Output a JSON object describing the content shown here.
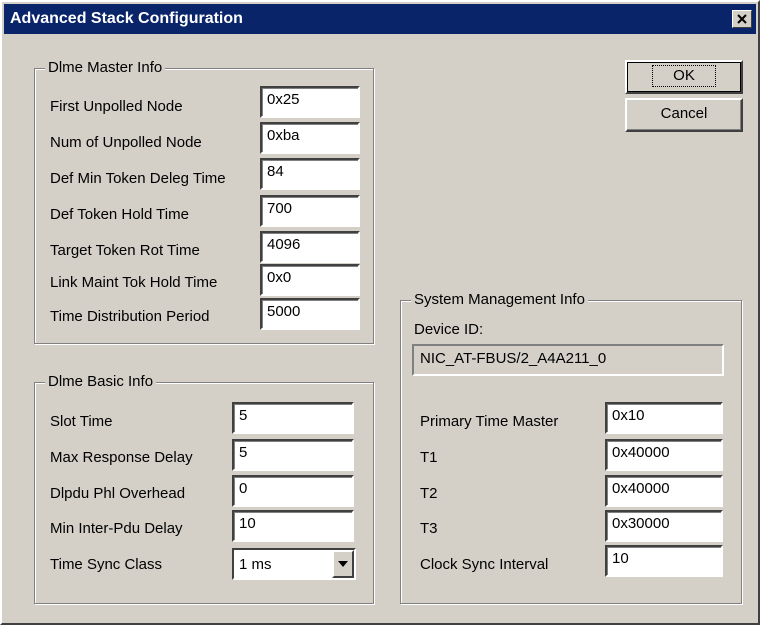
{
  "window": {
    "title": "Advanced Stack Configuration"
  },
  "buttons": {
    "ok": "OK",
    "cancel": "Cancel"
  },
  "dlme_master": {
    "legend": "Dlme Master Info",
    "fields": [
      {
        "label": "First Unpolled Node",
        "value": "0x25"
      },
      {
        "label": "Num of Unpolled Node",
        "value": "0xba"
      },
      {
        "label": "Def Min Token Deleg Time",
        "value": "84"
      },
      {
        "label": "Def Token Hold Time",
        "value": "700"
      },
      {
        "label": "Target Token Rot Time",
        "value": "4096"
      },
      {
        "label": "Link Maint Tok Hold Time",
        "value": "0x0"
      },
      {
        "label": "Time Distribution Period",
        "value": "5000"
      }
    ]
  },
  "dlme_basic": {
    "legend": "Dlme Basic Info",
    "fields": [
      {
        "label": "Slot Time",
        "value": "5"
      },
      {
        "label": "Max Response Delay",
        "value": "5"
      },
      {
        "label": "Dlpdu Phl Overhead",
        "value": "0"
      },
      {
        "label": "Min Inter-Pdu Delay",
        "value": "10"
      }
    ],
    "time_sync": {
      "label": "Time Sync Class",
      "value": "1 ms"
    }
  },
  "system_mgmt": {
    "legend": "System Management Info",
    "device_id_label": "Device ID:",
    "device_id": "NIC_AT-FBUS/2_A4A211_0",
    "fields": [
      {
        "label": "Primary Time Master",
        "value": "0x10"
      },
      {
        "label": "T1",
        "value": "0x40000"
      },
      {
        "label": "T2",
        "value": "0x40000"
      },
      {
        "label": "T3",
        "value": "0x30000"
      },
      {
        "label": "Clock Sync Interval",
        "value": "10"
      }
    ]
  }
}
